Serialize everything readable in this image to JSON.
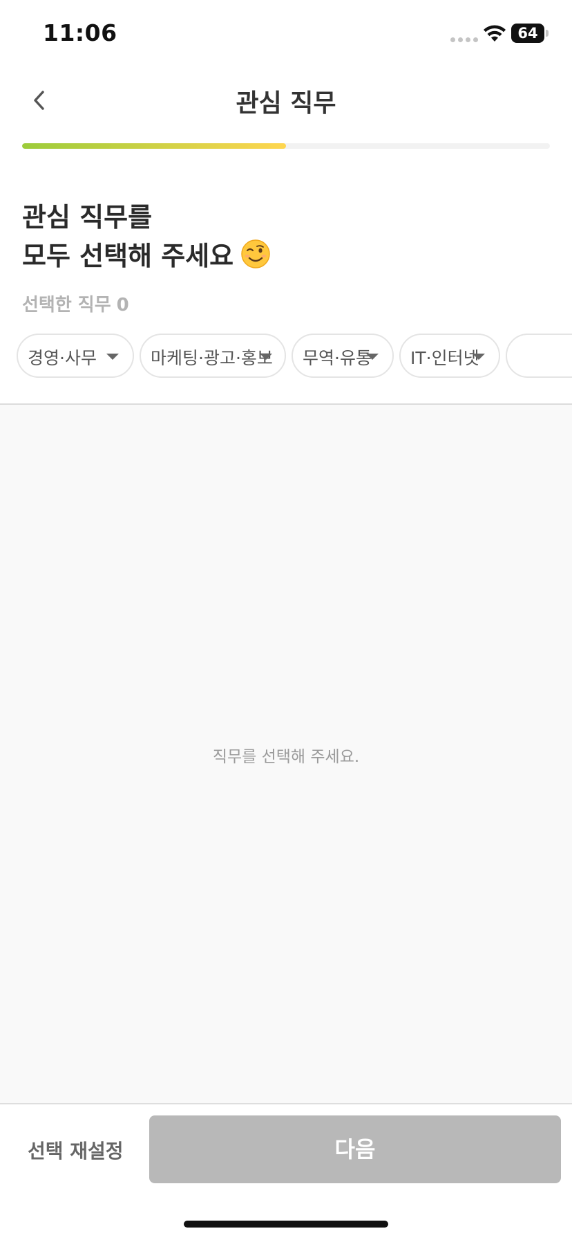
{
  "status_bar": {
    "time": "11:06",
    "battery": "64",
    "wifi_icon": "wifi-icon",
    "signal_icon": "signal-dots-icon"
  },
  "header": {
    "title": "관심 직무",
    "back_icon": "chevron-left-icon"
  },
  "progress": {
    "fraction": 0.5
  },
  "heading": {
    "line1": "관심 직무를",
    "line2": "모두 선택해 주세요",
    "emoji_icon": "winking-face-icon"
  },
  "selected": {
    "label": "선택한 직무",
    "count": "0"
  },
  "categories": [
    {
      "label": "경영·사무"
    },
    {
      "label": "마케팅·광고·홍보"
    },
    {
      "label": "무역·유통"
    },
    {
      "label": "IT·인터넷"
    }
  ],
  "empty_message": "직무를 선택해 주세요.",
  "footer": {
    "reset_label": "선택 재설정",
    "next_label": "다음"
  },
  "colors": {
    "progress_start": "#9ccc3a",
    "progress_end": "#ffd650",
    "next_disabled": "#b8b8b8"
  }
}
